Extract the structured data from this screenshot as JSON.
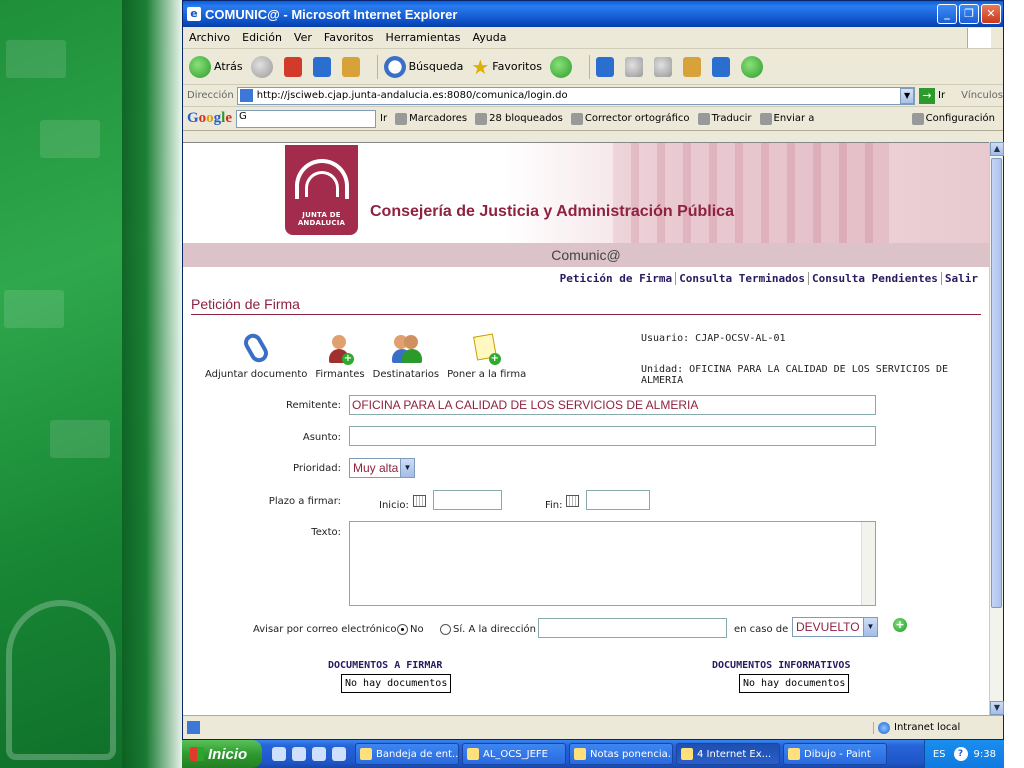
{
  "window": {
    "title": "COMUNIC@ - Microsoft Internet Explorer",
    "minimize": "_",
    "maximize": "❐",
    "close": "✕"
  },
  "menubar": [
    "Archivo",
    "Edición",
    "Ver",
    "Favoritos",
    "Herramientas",
    "Ayuda"
  ],
  "toolbar": {
    "back": "Atrás",
    "search": "Búsqueda",
    "favorites": "Favoritos"
  },
  "address": {
    "label": "Dirección",
    "url": "http://jsciweb.cjap.junta-andalucia.es:8080/comunica/login.do",
    "go": "Ir",
    "links": "Vínculos"
  },
  "googlebar": {
    "search_value": "G",
    "go": "Ir",
    "bookmarks": "Marcadores",
    "blocked": "28 bloqueados",
    "spell": "Corrector ortográfico",
    "translate": "Traducir",
    "send": "Enviar a",
    "settings": "Configuración"
  },
  "page": {
    "logo_text": "JUNTA DE ANDALUCIA",
    "department": "Consejería de Justicia y Administración Pública",
    "app_name": "Comunic@",
    "nav": [
      "Petición de Firma",
      "Consulta Terminados",
      "Consulta Pendientes",
      "Salir"
    ],
    "section_title": "Petición de Firma",
    "actions": {
      "attach": "Adjuntar documento",
      "signers": "Firmantes",
      "recipients": "Destinatarios",
      "sign": "Poner a la firma"
    },
    "user_line": "Usuario: CJAP-OCSV-AL-01",
    "unit_line": "Unidad: OFICINA PARA LA CALIDAD DE LOS SERVICIOS DE ALMERIA",
    "form": {
      "sender_label": "Remitente:",
      "sender_value": "OFICINA PARA LA CALIDAD DE LOS SERVICIOS DE ALMERIA",
      "subject_label": "Asunto:",
      "subject_value": "",
      "priority_label": "Prioridad:",
      "priority_value": "Muy alta",
      "deadline_label": "Plazo a firmar:",
      "start_label": "Inicio:",
      "end_label": "Fin:",
      "start_value": "",
      "end_value": "",
      "text_label": "Texto:",
      "notify_label": "Avisar por correo electrónico",
      "no_label": "No",
      "yes_label": "Sí. A la dirección",
      "email_value": "",
      "case_label": "en caso de",
      "case_value": "DEVUELTO",
      "add": "+"
    },
    "docs_to_sign": {
      "title": "DOCUMENTOS A FIRMAR",
      "empty": "No hay documentos"
    },
    "docs_info": {
      "title": "DOCUMENTOS INFORMATIVOS",
      "empty": "No hay documentos"
    }
  },
  "status": {
    "zone": "Intranet local"
  },
  "taskbar": {
    "start": "Inicio",
    "tasks": [
      "Bandeja de ent...",
      "AL_OCS_JEFE",
      "Notas ponencia...",
      "4 Internet Ex...",
      "Dibujo - Paint"
    ],
    "lang": "ES",
    "time": "9:38"
  }
}
